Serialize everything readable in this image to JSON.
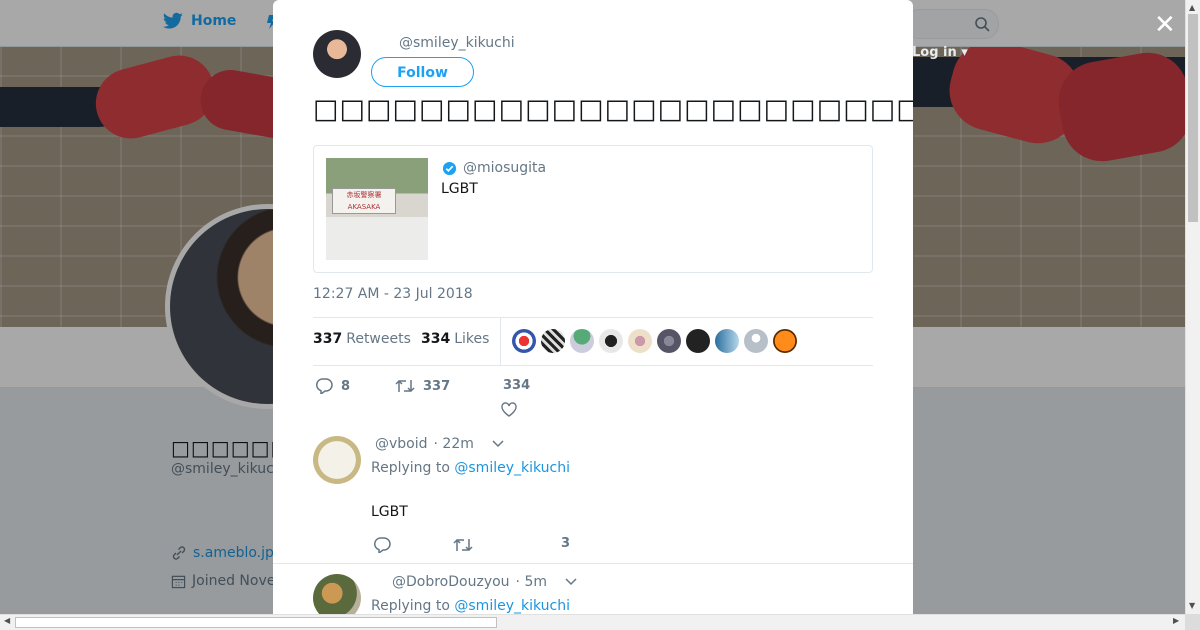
{
  "topbar": {
    "home_label": "Home",
    "login_label": "Log in"
  },
  "background_profile": {
    "display_name": "□□□□□□□□",
    "handle": "@smiley_kikuc",
    "link": "s.ameblo.jp",
    "joined": "Joined Nove"
  },
  "modal": {
    "close_symbol": "✕",
    "author_handle": "@smiley_kikuchi",
    "follow_label": "Follow",
    "tweet_text": "□□□□□□□□□□□□□□□□□□□□□□□□□□□□□□□□□□□□□□□□□□□□□□□□□□",
    "quote": {
      "handle": "@miosugita",
      "text": "LGBT",
      "sign_text": "赤坂警察署"
    },
    "timestamp": "12:27 AM - 23 Jul 2018",
    "retweets_count": "337",
    "retweets_label": "Retweets",
    "likes_count": "334",
    "likes_label": "Likes",
    "actions": {
      "reply_count": "8",
      "retweet_count": "337",
      "like_count": "334"
    },
    "replies": [
      {
        "handle": "@vboid",
        "time": "· 22m",
        "replying_prefix": "Replying to",
        "replying_to": "@smiley_kikuchi",
        "text": "LGBT",
        "like_count": "3"
      },
      {
        "handle": "@DobroDouzyou",
        "time": "· 5m",
        "replying_prefix": "Replying to",
        "replying_to": "@smiley_kikuchi"
      }
    ]
  },
  "colors": {
    "accent": "#1da1f2",
    "link": "#1b95e0",
    "muted": "#657786",
    "text": "#14171a"
  },
  "icons": [
    "twitter-bird-icon",
    "moments-icon",
    "search-icon",
    "close-icon",
    "verified-icon",
    "reply-icon",
    "retweet-icon",
    "heart-icon",
    "chevron-down-icon",
    "link-icon",
    "calendar-icon"
  ]
}
